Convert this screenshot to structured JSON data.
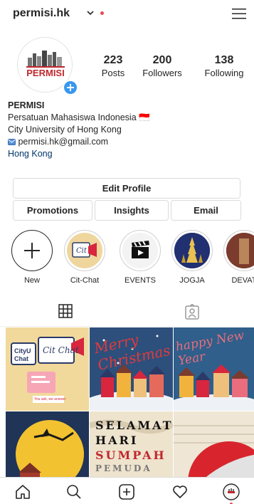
{
  "header": {
    "username": "permisi.hk",
    "icons": {
      "dropdown": "chevron-down-icon",
      "menu": "hamburger-menu-icon"
    },
    "notification_color": "#ed4956"
  },
  "profile": {
    "avatar_text": "PERMISI",
    "avatar_icon": "add-story-plus-icon",
    "stats": {
      "posts": {
        "count": "223",
        "label": "Posts"
      },
      "followers": {
        "count": "200",
        "label": "Followers"
      },
      "following": {
        "count": "138",
        "label": "Following"
      }
    },
    "bio": {
      "name": "PERMISI",
      "line1": "Persatuan Mahasiswa Indonesia",
      "line1_flag": "🇮🇩",
      "line2": "City University of Hong Kong",
      "email": "permisi.hk@gmail.com",
      "email_icon": "envelope-icon",
      "location": "Hong Kong"
    }
  },
  "buttons": {
    "edit_profile": "Edit Profile",
    "promotions": "Promotions",
    "insights": "Insights",
    "email": "Email"
  },
  "highlights": [
    {
      "label": "New",
      "icon": "plus-icon"
    },
    {
      "label": "Cit-Chat",
      "icon": "chat-megaphone-icon"
    },
    {
      "label": "EVENTS",
      "icon": "clapperboard-icon"
    },
    {
      "label": "JOGJA",
      "icon": "temple-icon"
    },
    {
      "label": "DEVAT",
      "icon": "photo-icon"
    }
  ],
  "tabs": [
    {
      "icon": "grid-icon",
      "active": true
    },
    {
      "icon": "tagged-person-icon",
      "active": false
    }
  ],
  "posts": {
    "tile1": {
      "line1": "CityU",
      "line2": "Chat",
      "logo": "Cit Chat",
      "caption": "You ask, we answer"
    },
    "tile2": {
      "text": "Merry Christmas"
    },
    "tile3": {
      "text": "happy New Year"
    },
    "tile4": {
      "text": ""
    },
    "tile5": {
      "line1": "SELAMAT",
      "line2": "HARI",
      "line3": "SUMPAH",
      "line4": "PEMUDA"
    },
    "tile6": {
      "text": ""
    }
  },
  "bottom_nav": [
    {
      "icon": "home-icon"
    },
    {
      "icon": "search-icon"
    },
    {
      "icon": "new-post-icon"
    },
    {
      "icon": "activity-heart-icon"
    },
    {
      "icon": "profile-avatar-icon"
    }
  ],
  "colors": {
    "accent_blue": "#3897f0",
    "text": "#262626",
    "border": "#dbdbdb",
    "link": "#003569"
  }
}
